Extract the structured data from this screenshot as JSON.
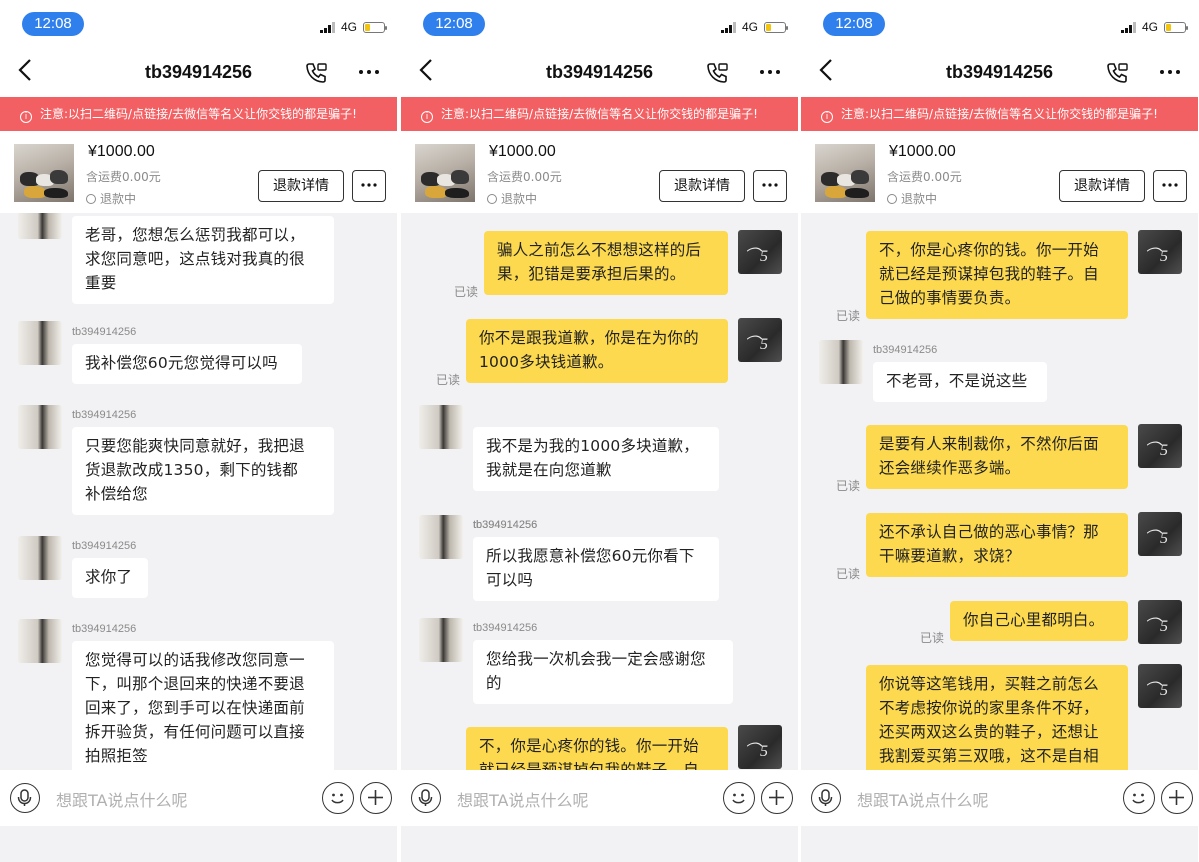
{
  "screens": [
    {
      "status_time": "12:08",
      "network": "4G",
      "title": "tb394914256",
      "warning": "注意:以扫二维码/点链接/去微信等名义让你交钱的都是骗子!",
      "product": {
        "price": "¥1000.00",
        "shipping": "含运费0.00元",
        "status": "退款中",
        "refund_button": "退款详情"
      },
      "messages": [
        {
          "from": "other",
          "name": "",
          "text": "老哥，您想怎么惩罚我都可以，\n求您同意吧，这点钱对我真的很\n重要"
        },
        {
          "from": "other",
          "name": "tb394914256",
          "text": "我补偿您60元您觉得可以吗"
        },
        {
          "from": "other",
          "name": "tb394914256",
          "text": "只要您能爽快同意就好，我把退\n货退款改成1350，剩下的钱都\n补偿给您"
        },
        {
          "from": "other",
          "name": "tb394914256",
          "text": "求你了"
        },
        {
          "from": "other",
          "name": "tb394914256",
          "text": "您觉得可以的话我修改您同意一\n下，叫那个退回来的快递不要退\n回来了，您到手可以在快递面前\n拆开验货，有任何问题可以直接\n拍照拒签"
        }
      ],
      "input_placeholder": "想跟TA说点什么呢"
    },
    {
      "status_time": "12:08",
      "network": "4G",
      "title": "tb394914256",
      "warning": "注意:以扫二维码/点链接/去微信等名义让你交钱的都是骗子!",
      "product": {
        "price": "¥1000.00",
        "shipping": "含运费0.00元",
        "status": "退款中",
        "refund_button": "退款详情"
      },
      "messages": [
        {
          "from": "self",
          "read": "已读",
          "text": "骗人之前怎么不想想这样的后\n果，犯错是要承担后果的。"
        },
        {
          "from": "self",
          "read": "已读",
          "text": "你不是跟我道歉，你是在为你的\n1000多块钱道歉。"
        },
        {
          "from": "other",
          "name": "tb394914256",
          "text": "我不是为我的1000多块道歉，\n我就是在向您道歉"
        },
        {
          "from": "other",
          "name": "tb394914256",
          "text": "所以我愿意补偿您60元你看下\n可以吗"
        },
        {
          "from": "other",
          "name": "tb394914256",
          "text": "您给我一次机会我一定会感谢您\n的"
        },
        {
          "from": "self",
          "read": "",
          "text": "不，你是心疼你的钱。你一开始\n就已经是预谋掉包我的鞋子。自"
        }
      ],
      "input_placeholder": "想跟TA说点什么呢"
    },
    {
      "status_time": "12:08",
      "network": "4G",
      "title": "tb394914256",
      "warning": "注意:以扫二维码/点链接/去微信等名义让你交钱的都是骗子!",
      "product": {
        "price": "¥1000.00",
        "shipping": "含运费0.00元",
        "status": "退款中",
        "refund_button": "退款详情"
      },
      "messages": [
        {
          "from": "self",
          "read": "已读",
          "text": "不，你是心疼你的钱。你一开始\n就已经是预谋掉包我的鞋子。自\n己做的事情要负责。"
        },
        {
          "from": "other",
          "name": "tb394914256",
          "text": "不老哥，不是说这些"
        },
        {
          "from": "self",
          "read": "已读",
          "text": "是要有人来制裁你，不然你后面\n还会继续作恶多端。"
        },
        {
          "from": "self",
          "read": "已读",
          "text": "还不承认自己做的恶心事情？那\n干嘛要道歉，求饶？"
        },
        {
          "from": "self",
          "read": "已读",
          "text": "你自己心里都明白。"
        },
        {
          "from": "self",
          "read": "",
          "text": "你说等这笔钱用，买鞋之前怎么\n不考虑按你说的家里条件不好，\n还买两双这么贵的鞋子，还想让\n我割爱买第三双哦，这不是自相"
        }
      ],
      "input_placeholder": "想跟TA说点什么呢"
    }
  ]
}
